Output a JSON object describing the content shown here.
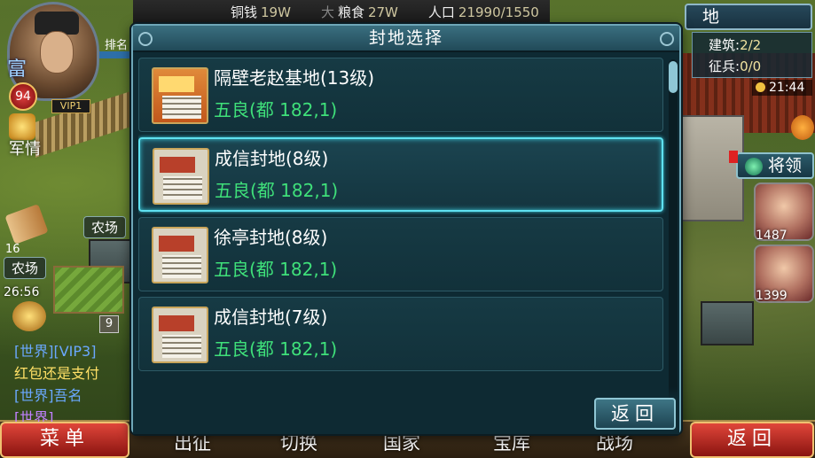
{
  "resources": {
    "copper_label": "铜钱",
    "copper_value": "19W",
    "food_prefix": "大",
    "food_label": "粮食",
    "food_value": "27W",
    "pop_label": "人口",
    "pop_value": "21990/1550"
  },
  "player": {
    "rank_label": "排名",
    "title_char": "富",
    "level": "94",
    "vip": "VIP1"
  },
  "left_hud": {
    "military_label": "军情",
    "badge_count": "16",
    "farm_tag_1": "农场",
    "farm_tag_2": "农场",
    "timer": "26:56",
    "crop_count": "9"
  },
  "chat": {
    "line1": "[世界][VIP3]",
    "line2": "红包还是支付",
    "line3": "[世界]吾名",
    "line4": "[世界]"
  },
  "right_hud": {
    "panel_title": "地",
    "building_label": "建筑:",
    "building_value": "2/2",
    "conscript_label": "征兵:",
    "conscript_value": "0/0",
    "clock": "21:44",
    "generals_label": "将领",
    "hero1_power": "1487",
    "hero2_power": "1399"
  },
  "bottom_nav": {
    "menu": "菜单",
    "expedition": "出征",
    "switch": "切换",
    "nation": "国家",
    "treasury": "宝库",
    "battlefield": "战场",
    "back": "返回"
  },
  "dialog": {
    "title": "封地选择",
    "back_label": "返回",
    "items": [
      {
        "name": "隔壁老赵基地(13级)",
        "location": "五良(都 182,1)",
        "selected": false
      },
      {
        "name": "成信封地(8级)",
        "location": "五良(都 182,1)",
        "selected": true
      },
      {
        "name": "徐亭封地(8级)",
        "location": "五良(都 182,1)",
        "selected": false
      },
      {
        "name": "成信封地(7级)",
        "location": "五良(都 182,1)",
        "selected": false
      }
    ]
  }
}
